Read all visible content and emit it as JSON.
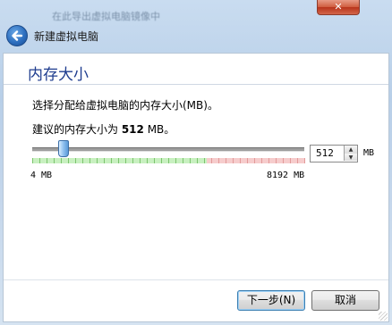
{
  "window": {
    "background_title": "在此导出虚拟电脑镜像中",
    "close_glyph": "✕",
    "wizard_title": "新建虚拟电脑"
  },
  "page": {
    "heading": "内存大小",
    "description": "选择分配给虚拟电脑的内存大小(MB)。",
    "recommended_prefix": "建议的内存大小为 ",
    "recommended_value": "512",
    "recommended_suffix": " MB。"
  },
  "memory_slider": {
    "value_mb": 512,
    "min_mb": 4,
    "max_mb": 8192,
    "min_label": "4 MB",
    "max_label": "8192 MB",
    "green_color": "#c8f0c0",
    "red_color": "#f6cccc"
  },
  "spinbox": {
    "value": "512",
    "unit": "MB",
    "up_glyph": "▲",
    "down_glyph": "▼"
  },
  "buttons": {
    "next_label": "下一步(N)",
    "cancel_label": "取消"
  },
  "icons": {
    "back": "back-arrow-icon",
    "close": "close-icon"
  }
}
